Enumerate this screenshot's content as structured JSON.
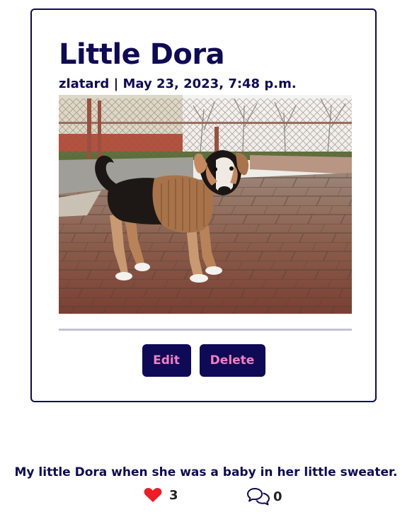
{
  "post": {
    "title": "Little Dora",
    "owner": "zlatard",
    "separator": "|",
    "created": "May 23, 2023, 7:48 p.m.",
    "image_alt": "Puppy in a brown knitted sweater standing on a tiled patio",
    "content": "My little Dora when she was a baby in her little sweater.",
    "likes_count": "3",
    "comments_count": "0"
  },
  "actions": {
    "edit_label": "Edit",
    "delete_label": "Delete"
  },
  "icons": {
    "like": "heart-icon",
    "comments": "comments-icon"
  },
  "colors": {
    "primary": "#0f0a55",
    "button_text": "#f07fc3",
    "heart": "#ee1c25",
    "divider": "#c3c3d2"
  }
}
